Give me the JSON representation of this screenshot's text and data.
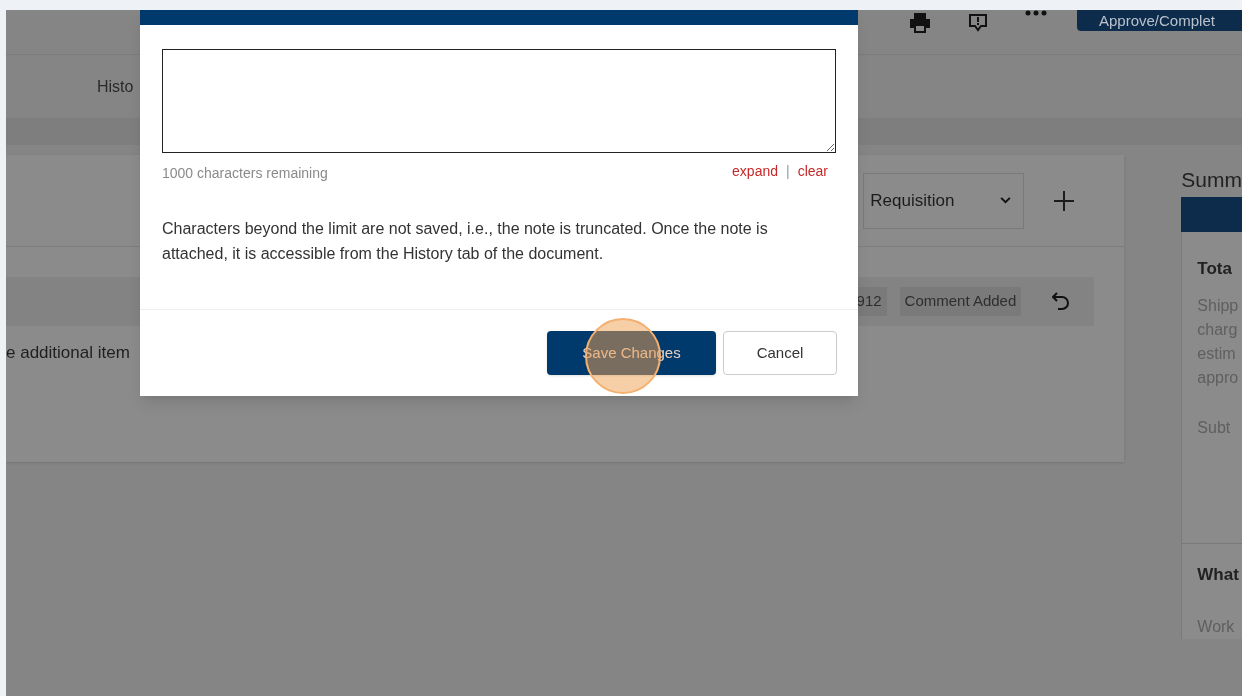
{
  "toolbar": {
    "primary_button": "Approve/Complet"
  },
  "tabs": [
    {
      "label": "Histo"
    }
  ],
  "notes_card": {
    "type_select": "Requisition",
    "history_tags": [
      "912",
      "Comment Added"
    ],
    "item_text": "e additional item"
  },
  "summary": {
    "title": "Summ",
    "total_heading": "Tota",
    "total_lines": [
      "Shipp",
      "charg",
      "estim",
      "appro"
    ],
    "subtotal_label": "Subt",
    "section_heading": "What",
    "section_text": "Work"
  },
  "dialog": {
    "counter": "1000 characters remaining",
    "links": [
      "expand",
      "clear"
    ],
    "separator": "|",
    "info": "Characters beyond the limit are not saved, i.e., the note is truncated. Once the note is attached, it is accessible from the History tab of the document.",
    "buttons": [
      {
        "label": "Save Changes",
        "kind": "primary"
      },
      {
        "label": "Cancel",
        "kind": "secondary"
      }
    ]
  }
}
